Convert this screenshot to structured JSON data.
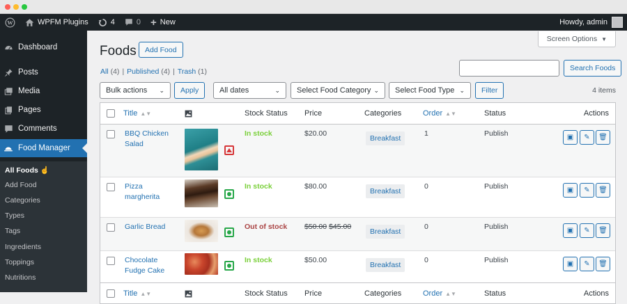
{
  "adminbar": {
    "site_name": "WPFM Plugins",
    "updates_count": "4",
    "comments_count": "0",
    "new_label": "New",
    "howdy": "Howdy, admin"
  },
  "sidebar": {
    "items": [
      {
        "label": "Dashboard",
        "icon": "dashboard-icon"
      },
      {
        "label": "Posts",
        "icon": "pushpin-icon"
      },
      {
        "label": "Media",
        "icon": "media-icon"
      },
      {
        "label": "Pages",
        "icon": "pages-icon"
      },
      {
        "label": "Comments",
        "icon": "comment-icon"
      },
      {
        "label": "Food Manager",
        "icon": "food-manager-icon"
      }
    ],
    "submenu": [
      "All Foods",
      "Add Food",
      "Categories",
      "Types",
      "Tags",
      "Ingredients",
      "Toppings",
      "Nutritions"
    ]
  },
  "main": {
    "screen_options": "Screen Options",
    "title": "Foods",
    "add_food": "Add Food",
    "filters": {
      "all": "All",
      "all_count": "(4)",
      "published": "Published",
      "published_count": "(4)",
      "trash": "Trash",
      "trash_count": "(1)"
    },
    "search_button": "Search Foods",
    "bulk_actions": "Bulk actions",
    "apply": "Apply",
    "all_dates": "All dates",
    "category_select": "Select Food Category",
    "type_select": "Select Food Type",
    "filter_button": "Filter",
    "items_count": "4 items"
  },
  "table": {
    "headers": {
      "title": "Title",
      "stock": "Stock Status",
      "price": "Price",
      "categories": "Categories",
      "order": "Order",
      "status": "Status",
      "actions": "Actions"
    },
    "rows": [
      {
        "title_line1": "BBQ Chicken",
        "title_line2": "Salad",
        "food_type": "non-veg",
        "stock": "In stock",
        "price": "$20.00",
        "old_price": "",
        "category": "Breakfast",
        "order": "1",
        "status": "Publish"
      },
      {
        "title_line1": "Pizza",
        "title_line2": "margherita",
        "food_type": "veg",
        "stock": "In stock",
        "price": "$80.00",
        "old_price": "",
        "category": "Breakfast",
        "order": "0",
        "status": "Publish"
      },
      {
        "title_line1": "Garlic Bread",
        "title_line2": "",
        "food_type": "veg",
        "stock": "Out of stock",
        "price": "$45.00",
        "old_price": "$50.00",
        "category": "Breakfast",
        "order": "0",
        "status": "Publish"
      },
      {
        "title_line1": "Chocolate",
        "title_line2": "Fudge Cake",
        "food_type": "veg",
        "stock": "In stock",
        "price": "$50.00",
        "old_price": "",
        "category": "Breakfast",
        "order": "0",
        "status": "Publish"
      }
    ]
  }
}
